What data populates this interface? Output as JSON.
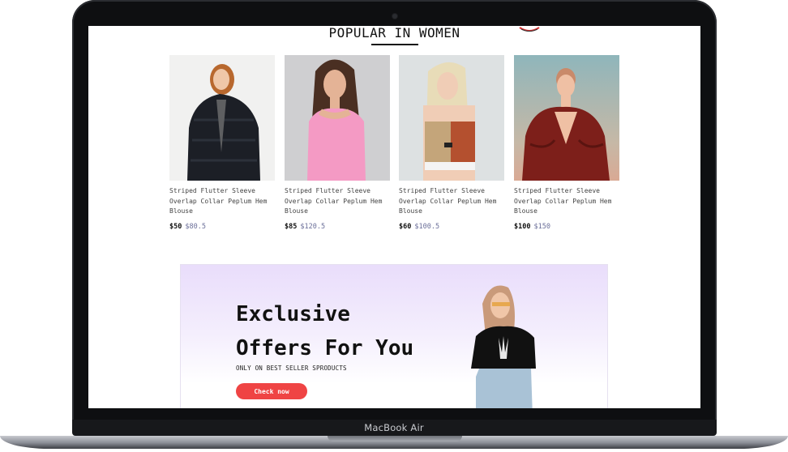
{
  "device": {
    "label": "MacBook Air"
  },
  "section": {
    "title": "POPULAR IN WOMEN"
  },
  "products": [
    {
      "name": "Striped Flutter Sleeve Overlap Collar Peplum Hem Blouse",
      "price": "$50",
      "old_price": "$80.5"
    },
    {
      "name": "Striped Flutter Sleeve Overlap Collar Peplum Hem Blouse",
      "price": "$85",
      "old_price": "$120.5"
    },
    {
      "name": "Striped Flutter Sleeve Overlap Collar Peplum Hem Blouse",
      "price": "$60",
      "old_price": "$100.5"
    },
    {
      "name": "Striped Flutter Sleeve Overlap Collar Peplum Hem Blouse",
      "price": "$100",
      "old_price": "$150"
    }
  ],
  "banner": {
    "title": "Exclusive\nOffers For You",
    "subtitle": "ONLY ON BEST SELLER SPRODUCTS",
    "button": "Check now"
  },
  "colors": {
    "accent": "#ef4444",
    "old_price": "#6b6f99",
    "banner_top": "#e9ddfb"
  }
}
